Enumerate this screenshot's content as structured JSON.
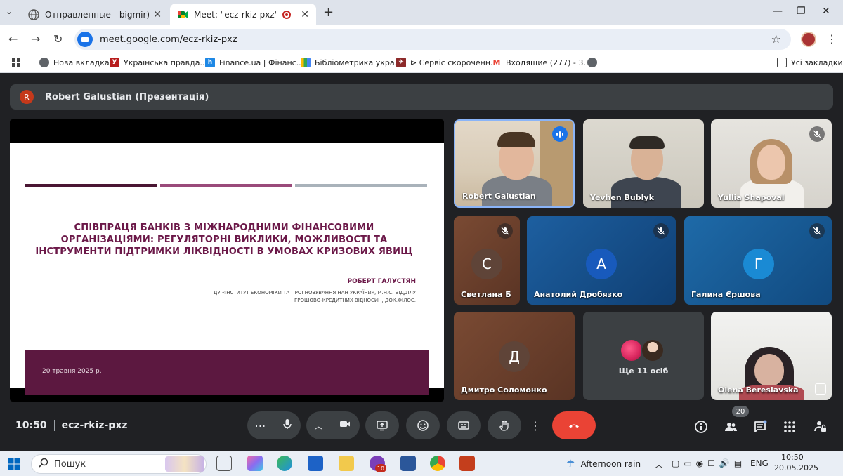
{
  "browser": {
    "tabs": [
      {
        "title": "Отправленные - bigmir)net",
        "active": false
      },
      {
        "title": "Meet: \"ecz-rkiz-pxz\"",
        "active": true
      }
    ],
    "url": "meet.google.com/ecz-rkiz-pxz",
    "bookmarks": [
      "Нова вкладка",
      "Українська правда...",
      "Finance.ua | Фінанс...",
      "Бібліометрика укра...",
      "⊳ Сервіс скороченн...",
      "Входящие (277) - 3...",
      "Усі закладки"
    ]
  },
  "meet": {
    "presenter_initial": "R",
    "presenter_label": "Robert Galustian (Презентація)",
    "slide": {
      "title": "Співпраця банків з міжнародними фінансовими організаціями: регуляторні виклики, можливості та інструменти підтримки ліквідності в умовах кризових явищ",
      "author": "РОБЕРТ ГАЛУСТЯН",
      "affiliation": "ДУ «Інститут економіки та прогнозування НАН України», м.н.с. відділу грошово-кредитних відносин, док.філос.",
      "date": "20 травня 2025 р."
    },
    "participants": [
      {
        "name": "Robert Galustian",
        "speaking": true
      },
      {
        "name": "Yevhen Bublyk"
      },
      {
        "name": "Yulia Shapoval",
        "display": "Yullia Shapoval",
        "muted": true
      },
      {
        "name": "Светлана Б",
        "initial": "С",
        "muted": true
      },
      {
        "name": "Анатолий Дробязко",
        "initial": "А",
        "muted": true
      },
      {
        "name": "Галина Єршова",
        "initial": "Г",
        "muted": true
      },
      {
        "name": "Дмитро Соломонко",
        "initial": "Д"
      },
      {
        "name": "Ще 11 осіб"
      },
      {
        "name": "Olena Bereslavska"
      }
    ],
    "time": "10:50",
    "meeting_code": "ecz-rkiz-pxz",
    "participant_count": "20"
  },
  "taskbar": {
    "search_label": "Пошук",
    "weather": "Afternoon rain",
    "lang": "ENG",
    "time": "10:50",
    "date": "20.05.2025",
    "badge": "10"
  },
  "colors": {
    "meet_bg": "#202124",
    "control_bg": "#3c4043",
    "hangup": "#ea4335",
    "accent": "#1a73e8",
    "slide_accent": "#6b1848"
  }
}
